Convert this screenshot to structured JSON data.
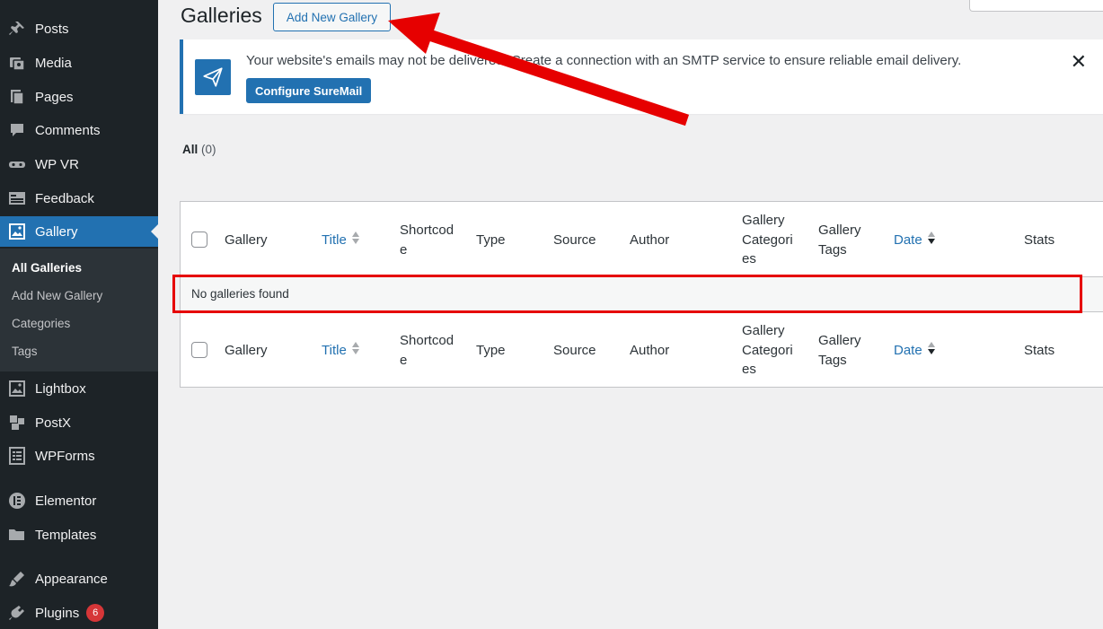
{
  "sidebar": {
    "items": [
      {
        "label": "Posts",
        "icon": "pin-icon"
      },
      {
        "label": "Media",
        "icon": "media-icon"
      },
      {
        "label": "Pages",
        "icon": "pages-icon"
      },
      {
        "label": "Comments",
        "icon": "comments-icon"
      },
      {
        "label": "WP VR",
        "icon": "vr-headset-icon"
      },
      {
        "label": "Feedback",
        "icon": "feedback-icon"
      },
      {
        "label": "Gallery",
        "icon": "gallery-icon"
      },
      {
        "label": "Lightbox",
        "icon": "lightbox-icon"
      },
      {
        "label": "PostX",
        "icon": "postx-icon"
      },
      {
        "label": "WPForms",
        "icon": "wpforms-icon"
      },
      {
        "label": "Elementor",
        "icon": "elementor-icon"
      },
      {
        "label": "Templates",
        "icon": "folder-icon"
      },
      {
        "label": "Appearance",
        "icon": "brush-icon"
      },
      {
        "label": "Plugins",
        "icon": "plugin-icon",
        "badge": "6"
      }
    ],
    "gallery_submenu": [
      "All Galleries",
      "Add New Gallery",
      "Categories",
      "Tags"
    ]
  },
  "header": {
    "title": "Galleries",
    "add_new_label": "Add New Gallery"
  },
  "notice": {
    "text": "Your website's emails may not be delivered! Create a connection with an SMTP service to ensure reliable email delivery.",
    "button_label": "Configure SureMail",
    "close_glyph": "✕"
  },
  "filter": {
    "all_label": "All",
    "all_count": "(0)"
  },
  "table": {
    "columns": [
      {
        "line1": "Gallery",
        "line2": "",
        "line3": ""
      },
      {
        "line1": "Title",
        "line2": "",
        "line3": ""
      },
      {
        "line1": "Shortcod",
        "line2": "e",
        "line3": ""
      },
      {
        "line1": "Type",
        "line2": "",
        "line3": ""
      },
      {
        "line1": "Source",
        "line2": "",
        "line3": ""
      },
      {
        "line1": "Author",
        "line2": "",
        "line3": ""
      },
      {
        "line1": "Gallery",
        "line2": "Categori",
        "line3": "es"
      },
      {
        "line1": "Gallery",
        "line2": "Tags",
        "line3": ""
      },
      {
        "line1": "Date",
        "line2": "",
        "line3": ""
      },
      {
        "line1": "Stats",
        "line2": "",
        "line3": ""
      }
    ],
    "empty_message": "No galleries found"
  },
  "colors": {
    "accent": "#2271b1",
    "sidebar_bg": "#1d2327",
    "annotation": "#e60000"
  }
}
